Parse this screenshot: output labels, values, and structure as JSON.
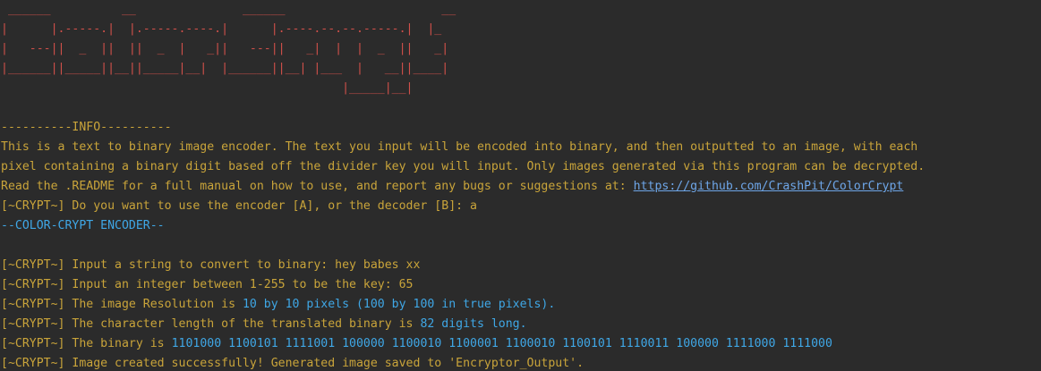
{
  "colors": {
    "background": "#2b2b2b",
    "ascii_art": "#d0504a",
    "output_text": "#c9a43a",
    "highlight": "#3fa7e6",
    "link": "#6ea6e8"
  },
  "banner": [
    " ______          __               ______                      __",
    "|      |.-----.|  |.-----.----.|      |.----.--.--.-----.|  |_",
    "|   ---||  _  ||  ||  _  |   _||   ---||   _|  |  |  _  ||   _|",
    "|______||_____||__||_____|__|  |______||__| |___  |   __||____|",
    "                                                |_____|__|"
  ],
  "info": {
    "header": "----------INFO----------",
    "line1": "This is a text to binary image encoder. The text you input will be encoded into binary, and then outputted to an image, with each",
    "line2": "pixel containing a binary digit based off the divider key you will input. Only images generated via this program can be decrypted.",
    "line3_prefix": "Read the .README for a full manual on how to use, and report any bugs or suggestions at: ",
    "link": "https://github.com/CrashPit/ColorCrypt"
  },
  "session": {
    "mode_prompt": "[~CRYPT~] Do you want to use the encoder [A], or the decoder [B]: a",
    "mode_title": "--COLOR-CRYPT ENCODER--",
    "string_prompt": "[~CRYPT~] Input a string to convert to binary: hey babes xx",
    "key_prompt": "[~CRYPT~] Input an integer between 1-255 to be the key: 65",
    "resolution_prefix": "[~CRYPT~] The image Resolution is ",
    "resolution_value": "10 by 10 pixels (100 by 100 in true pixels).",
    "length_prefix": "[~CRYPT~] The character length of the translated binary is ",
    "length_value": "82 digits long.",
    "binary_prefix": "[~CRYPT~] The binary is ",
    "binary_value": "1101000 1100101 1111001 100000 1100010 1100001 1100010 1100101 1110011 100000 1111000 1111000",
    "final_message": "[~CRYPT~] Image created successfully! Generated image saved to 'Encryptor_Output'."
  }
}
